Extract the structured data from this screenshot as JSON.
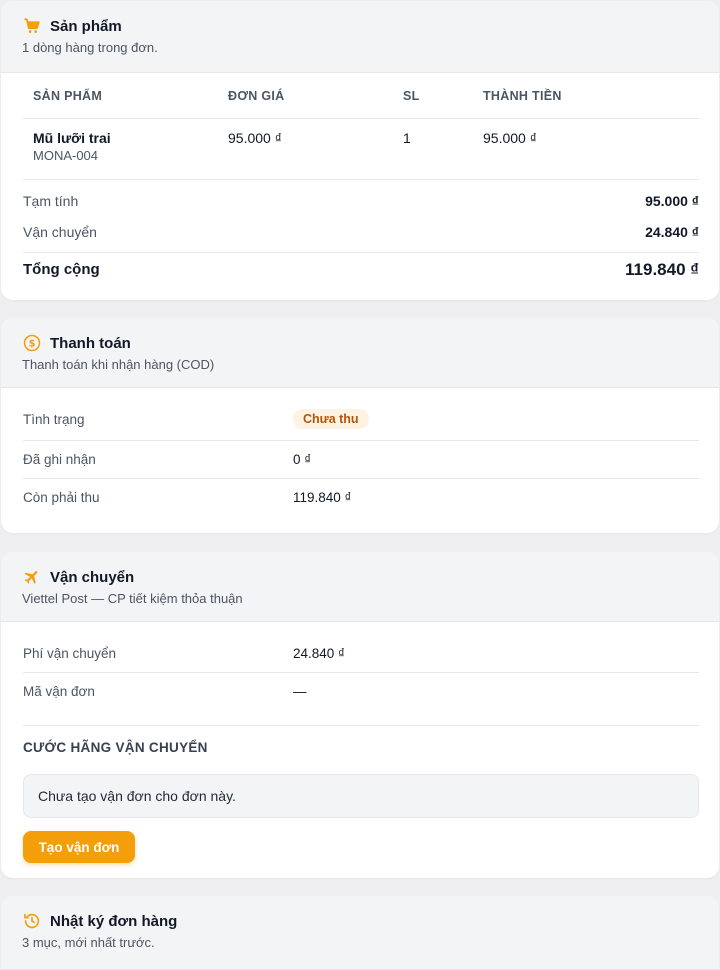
{
  "colors": {
    "accent": "#f59e0b",
    "badge_bg": "#fef3e2",
    "badge_text": "#b45309"
  },
  "products": {
    "icon": "cart-icon",
    "title": "Sản phẩm",
    "subtitle": "1 dòng hàng trong đơn.",
    "columns": [
      "SẢN PHẨM",
      "ĐƠN GIÁ",
      "SL",
      "THÀNH TIỀN"
    ],
    "rows": [
      {
        "name": "Mũ lưỡi trai",
        "sku": "MONA-004",
        "price": "95.000 ₫",
        "qty": "1",
        "total": "95.000 ₫"
      }
    ],
    "subtotal_label": "Tạm tính",
    "subtotal_value": "95.000 ₫",
    "shipping_label": "Vận chuyển",
    "shipping_value": "24.840 ₫",
    "total_label": "Tổng cộng",
    "total_value": "119.840 ₫"
  },
  "payment": {
    "icon": "dollar-coin-icon",
    "title": "Thanh toán",
    "subtitle": "Thanh toán khi nhận hàng (COD)",
    "status_label": "Tình trạng",
    "status_value": "Chưa thu",
    "received_label": "Đã ghi nhận",
    "received_value": "0 ₫",
    "remaining_label": "Còn phải thu",
    "remaining_value": "119.840 ₫"
  },
  "shipping": {
    "icon": "airplane-icon",
    "title": "Vận chuyển",
    "subtitle": "Viettel Post — CP tiết kiệm thỏa thuận",
    "fee_label": "Phí vận chuyển",
    "fee_value": "24.840 ₫",
    "tracking_label": "Mã vận đơn",
    "tracking_value": "—",
    "carrier_section_title": "CƯỚC HÃNG VẬN CHUYỂN",
    "empty_message": "Chưa tạo vận đơn cho đơn này.",
    "create_button": "Tạo vận đơn"
  },
  "log": {
    "icon": "history-icon",
    "title": "Nhật ký đơn hàng",
    "subtitle": "3 mục, mới nhất trước."
  }
}
